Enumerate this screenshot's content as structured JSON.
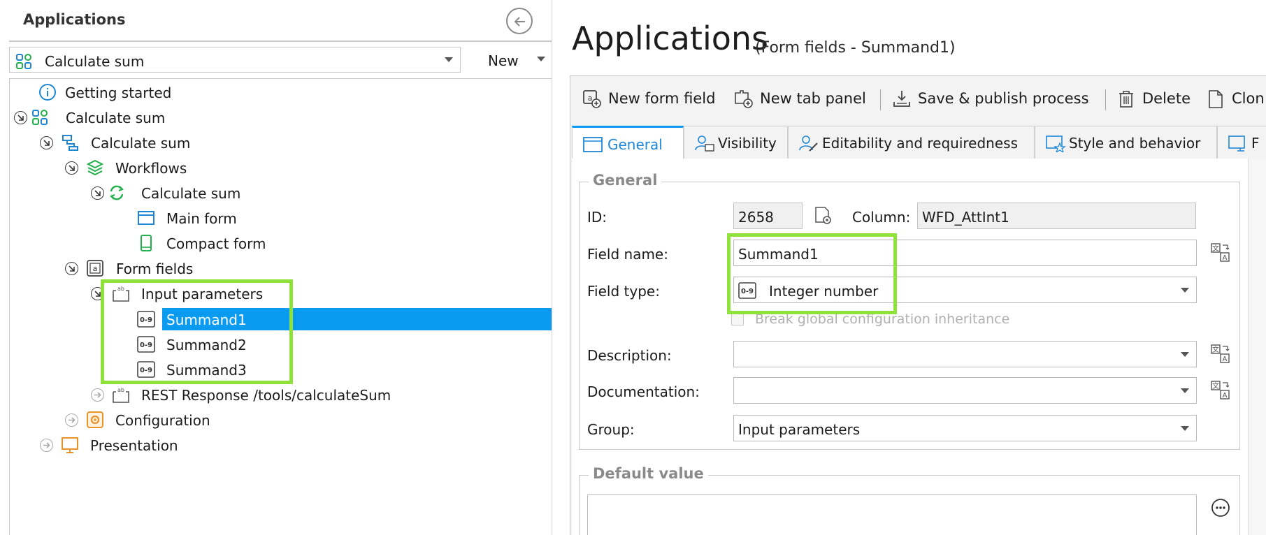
{
  "left_panel": {
    "header": "Applications",
    "app_select": {
      "value": "Calculate sum"
    },
    "new_button": "New",
    "tree": [
      {
        "label": "Getting started",
        "icon": "info-icon"
      },
      {
        "label": "Calculate sum",
        "icon": "app-icon"
      },
      {
        "label": "Calculate sum",
        "icon": "process-icon"
      },
      {
        "label": "Workflows",
        "icon": "workflows-icon"
      },
      {
        "label": "Calculate sum",
        "icon": "workflow-icon"
      },
      {
        "label": "Main form",
        "icon": "form-icon"
      },
      {
        "label": "Compact form",
        "icon": "mobile-icon"
      },
      {
        "label": "Form fields",
        "icon": "form-fields-icon"
      },
      {
        "label": "Input parameters",
        "icon": "group-icon"
      },
      {
        "label": "Summand1",
        "icon": "integer-icon",
        "selected": true
      },
      {
        "label": "Summand2",
        "icon": "integer-icon"
      },
      {
        "label": "Summand3",
        "icon": "integer-icon"
      },
      {
        "label": "REST Response /tools/calculateSum",
        "icon": "group-icon"
      },
      {
        "label": "Configuration",
        "icon": "config-icon"
      },
      {
        "label": "Presentation",
        "icon": "presentation-icon"
      }
    ]
  },
  "right_panel": {
    "title": "Applications",
    "subtitle": "(Form fields - Summand1)",
    "toolbar": {
      "new_form_field": "New form field",
      "new_tab_panel": "New tab panel",
      "save_publish": "Save & publish process",
      "delete": "Delete",
      "clone": "Clon"
    },
    "tabs": {
      "general": "General",
      "visibility": "Visibility",
      "editability": "Editability and requiredness",
      "style": "Style and behavior",
      "more": "F"
    },
    "general_group": {
      "title": "General",
      "id_label": "ID:",
      "id_value": "2658",
      "column_label": "Column:",
      "column_value": "WFD_AttInt1",
      "field_name_label": "Field name:",
      "field_name_value": "Summand1",
      "field_type_label": "Field type:",
      "field_type_value": "Integer number",
      "field_type_badge": "0-9",
      "break_inheritance": "Break global configuration inheritance",
      "description_label": "Description:",
      "description_value": "",
      "documentation_label": "Documentation:",
      "documentation_value": "",
      "group_label": "Group:",
      "group_value": "Input parameters"
    },
    "default_value_group": {
      "title": "Default value"
    }
  },
  "colors": {
    "selection": "#0a9bf0",
    "highlight": "#8ee23a",
    "accent_green": "#21b04b",
    "icon_blue": "#1f86d6",
    "config_orange": "#e8932c"
  }
}
